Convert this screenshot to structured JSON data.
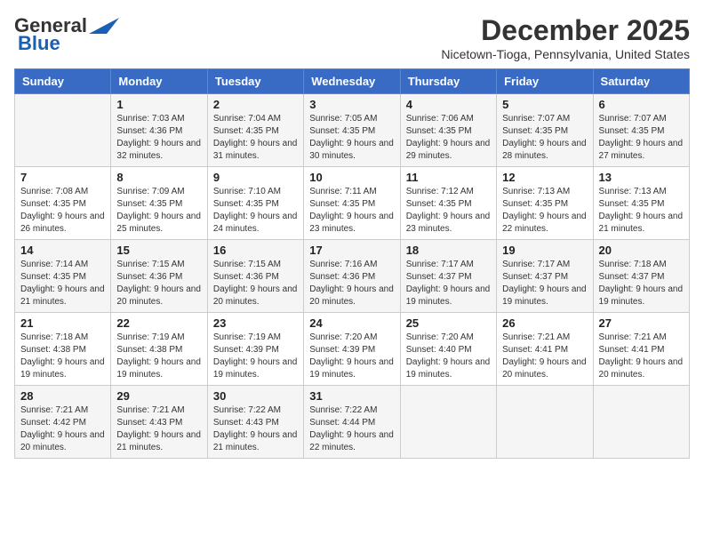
{
  "logo": {
    "line1": "General",
    "line2": "Blue"
  },
  "title": "December 2025",
  "subtitle": "Nicetown-Tioga, Pennsylvania, United States",
  "days_of_week": [
    "Sunday",
    "Monday",
    "Tuesday",
    "Wednesday",
    "Thursday",
    "Friday",
    "Saturday"
  ],
  "weeks": [
    [
      {
        "day": "",
        "sunrise": "",
        "sunset": "",
        "daylight": ""
      },
      {
        "day": "1",
        "sunrise": "Sunrise: 7:03 AM",
        "sunset": "Sunset: 4:36 PM",
        "daylight": "Daylight: 9 hours and 32 minutes."
      },
      {
        "day": "2",
        "sunrise": "Sunrise: 7:04 AM",
        "sunset": "Sunset: 4:35 PM",
        "daylight": "Daylight: 9 hours and 31 minutes."
      },
      {
        "day": "3",
        "sunrise": "Sunrise: 7:05 AM",
        "sunset": "Sunset: 4:35 PM",
        "daylight": "Daylight: 9 hours and 30 minutes."
      },
      {
        "day": "4",
        "sunrise": "Sunrise: 7:06 AM",
        "sunset": "Sunset: 4:35 PM",
        "daylight": "Daylight: 9 hours and 29 minutes."
      },
      {
        "day": "5",
        "sunrise": "Sunrise: 7:07 AM",
        "sunset": "Sunset: 4:35 PM",
        "daylight": "Daylight: 9 hours and 28 minutes."
      },
      {
        "day": "6",
        "sunrise": "Sunrise: 7:07 AM",
        "sunset": "Sunset: 4:35 PM",
        "daylight": "Daylight: 9 hours and 27 minutes."
      }
    ],
    [
      {
        "day": "7",
        "sunrise": "Sunrise: 7:08 AM",
        "sunset": "Sunset: 4:35 PM",
        "daylight": "Daylight: 9 hours and 26 minutes."
      },
      {
        "day": "8",
        "sunrise": "Sunrise: 7:09 AM",
        "sunset": "Sunset: 4:35 PM",
        "daylight": "Daylight: 9 hours and 25 minutes."
      },
      {
        "day": "9",
        "sunrise": "Sunrise: 7:10 AM",
        "sunset": "Sunset: 4:35 PM",
        "daylight": "Daylight: 9 hours and 24 minutes."
      },
      {
        "day": "10",
        "sunrise": "Sunrise: 7:11 AM",
        "sunset": "Sunset: 4:35 PM",
        "daylight": "Daylight: 9 hours and 23 minutes."
      },
      {
        "day": "11",
        "sunrise": "Sunrise: 7:12 AM",
        "sunset": "Sunset: 4:35 PM",
        "daylight": "Daylight: 9 hours and 23 minutes."
      },
      {
        "day": "12",
        "sunrise": "Sunrise: 7:13 AM",
        "sunset": "Sunset: 4:35 PM",
        "daylight": "Daylight: 9 hours and 22 minutes."
      },
      {
        "day": "13",
        "sunrise": "Sunrise: 7:13 AM",
        "sunset": "Sunset: 4:35 PM",
        "daylight": "Daylight: 9 hours and 21 minutes."
      }
    ],
    [
      {
        "day": "14",
        "sunrise": "Sunrise: 7:14 AM",
        "sunset": "Sunset: 4:35 PM",
        "daylight": "Daylight: 9 hours and 21 minutes."
      },
      {
        "day": "15",
        "sunrise": "Sunrise: 7:15 AM",
        "sunset": "Sunset: 4:36 PM",
        "daylight": "Daylight: 9 hours and 20 minutes."
      },
      {
        "day": "16",
        "sunrise": "Sunrise: 7:15 AM",
        "sunset": "Sunset: 4:36 PM",
        "daylight": "Daylight: 9 hours and 20 minutes."
      },
      {
        "day": "17",
        "sunrise": "Sunrise: 7:16 AM",
        "sunset": "Sunset: 4:36 PM",
        "daylight": "Daylight: 9 hours and 20 minutes."
      },
      {
        "day": "18",
        "sunrise": "Sunrise: 7:17 AM",
        "sunset": "Sunset: 4:37 PM",
        "daylight": "Daylight: 9 hours and 19 minutes."
      },
      {
        "day": "19",
        "sunrise": "Sunrise: 7:17 AM",
        "sunset": "Sunset: 4:37 PM",
        "daylight": "Daylight: 9 hours and 19 minutes."
      },
      {
        "day": "20",
        "sunrise": "Sunrise: 7:18 AM",
        "sunset": "Sunset: 4:37 PM",
        "daylight": "Daylight: 9 hours and 19 minutes."
      }
    ],
    [
      {
        "day": "21",
        "sunrise": "Sunrise: 7:18 AM",
        "sunset": "Sunset: 4:38 PM",
        "daylight": "Daylight: 9 hours and 19 minutes."
      },
      {
        "day": "22",
        "sunrise": "Sunrise: 7:19 AM",
        "sunset": "Sunset: 4:38 PM",
        "daylight": "Daylight: 9 hours and 19 minutes."
      },
      {
        "day": "23",
        "sunrise": "Sunrise: 7:19 AM",
        "sunset": "Sunset: 4:39 PM",
        "daylight": "Daylight: 9 hours and 19 minutes."
      },
      {
        "day": "24",
        "sunrise": "Sunrise: 7:20 AM",
        "sunset": "Sunset: 4:39 PM",
        "daylight": "Daylight: 9 hours and 19 minutes."
      },
      {
        "day": "25",
        "sunrise": "Sunrise: 7:20 AM",
        "sunset": "Sunset: 4:40 PM",
        "daylight": "Daylight: 9 hours and 19 minutes."
      },
      {
        "day": "26",
        "sunrise": "Sunrise: 7:21 AM",
        "sunset": "Sunset: 4:41 PM",
        "daylight": "Daylight: 9 hours and 20 minutes."
      },
      {
        "day": "27",
        "sunrise": "Sunrise: 7:21 AM",
        "sunset": "Sunset: 4:41 PM",
        "daylight": "Daylight: 9 hours and 20 minutes."
      }
    ],
    [
      {
        "day": "28",
        "sunrise": "Sunrise: 7:21 AM",
        "sunset": "Sunset: 4:42 PM",
        "daylight": "Daylight: 9 hours and 20 minutes."
      },
      {
        "day": "29",
        "sunrise": "Sunrise: 7:21 AM",
        "sunset": "Sunset: 4:43 PM",
        "daylight": "Daylight: 9 hours and 21 minutes."
      },
      {
        "day": "30",
        "sunrise": "Sunrise: 7:22 AM",
        "sunset": "Sunset: 4:43 PM",
        "daylight": "Daylight: 9 hours and 21 minutes."
      },
      {
        "day": "31",
        "sunrise": "Sunrise: 7:22 AM",
        "sunset": "Sunset: 4:44 PM",
        "daylight": "Daylight: 9 hours and 22 minutes."
      },
      {
        "day": "",
        "sunrise": "",
        "sunset": "",
        "daylight": ""
      },
      {
        "day": "",
        "sunrise": "",
        "sunset": "",
        "daylight": ""
      },
      {
        "day": "",
        "sunrise": "",
        "sunset": "",
        "daylight": ""
      }
    ]
  ]
}
